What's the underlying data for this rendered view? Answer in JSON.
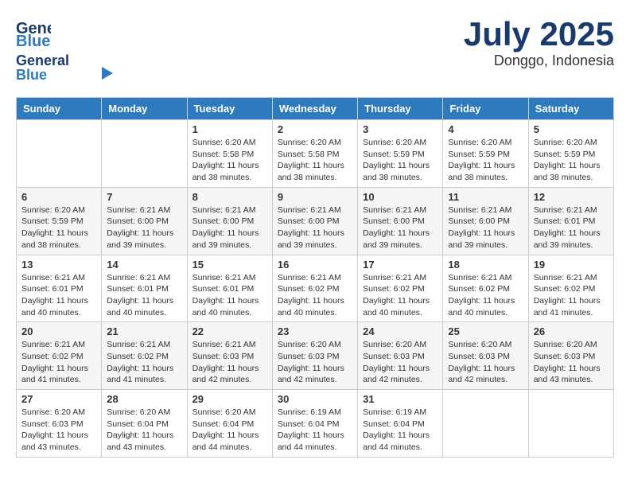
{
  "header": {
    "logo_line1": "General",
    "logo_line2": "Blue",
    "month": "July 2025",
    "location": "Donggo, Indonesia"
  },
  "weekdays": [
    "Sunday",
    "Monday",
    "Tuesday",
    "Wednesday",
    "Thursday",
    "Friday",
    "Saturday"
  ],
  "weeks": [
    [
      {
        "day": "",
        "content": ""
      },
      {
        "day": "",
        "content": ""
      },
      {
        "day": "1",
        "content": "Sunrise: 6:20 AM\nSunset: 5:58 PM\nDaylight: 11 hours and 38 minutes."
      },
      {
        "day": "2",
        "content": "Sunrise: 6:20 AM\nSunset: 5:58 PM\nDaylight: 11 hours and 38 minutes."
      },
      {
        "day": "3",
        "content": "Sunrise: 6:20 AM\nSunset: 5:59 PM\nDaylight: 11 hours and 38 minutes."
      },
      {
        "day": "4",
        "content": "Sunrise: 6:20 AM\nSunset: 5:59 PM\nDaylight: 11 hours and 38 minutes."
      },
      {
        "day": "5",
        "content": "Sunrise: 6:20 AM\nSunset: 5:59 PM\nDaylight: 11 hours and 38 minutes."
      }
    ],
    [
      {
        "day": "6",
        "content": "Sunrise: 6:20 AM\nSunset: 5:59 PM\nDaylight: 11 hours and 38 minutes."
      },
      {
        "day": "7",
        "content": "Sunrise: 6:21 AM\nSunset: 6:00 PM\nDaylight: 11 hours and 39 minutes."
      },
      {
        "day": "8",
        "content": "Sunrise: 6:21 AM\nSunset: 6:00 PM\nDaylight: 11 hours and 39 minutes."
      },
      {
        "day": "9",
        "content": "Sunrise: 6:21 AM\nSunset: 6:00 PM\nDaylight: 11 hours and 39 minutes."
      },
      {
        "day": "10",
        "content": "Sunrise: 6:21 AM\nSunset: 6:00 PM\nDaylight: 11 hours and 39 minutes."
      },
      {
        "day": "11",
        "content": "Sunrise: 6:21 AM\nSunset: 6:00 PM\nDaylight: 11 hours and 39 minutes."
      },
      {
        "day": "12",
        "content": "Sunrise: 6:21 AM\nSunset: 6:01 PM\nDaylight: 11 hours and 39 minutes."
      }
    ],
    [
      {
        "day": "13",
        "content": "Sunrise: 6:21 AM\nSunset: 6:01 PM\nDaylight: 11 hours and 40 minutes."
      },
      {
        "day": "14",
        "content": "Sunrise: 6:21 AM\nSunset: 6:01 PM\nDaylight: 11 hours and 40 minutes."
      },
      {
        "day": "15",
        "content": "Sunrise: 6:21 AM\nSunset: 6:01 PM\nDaylight: 11 hours and 40 minutes."
      },
      {
        "day": "16",
        "content": "Sunrise: 6:21 AM\nSunset: 6:02 PM\nDaylight: 11 hours and 40 minutes."
      },
      {
        "day": "17",
        "content": "Sunrise: 6:21 AM\nSunset: 6:02 PM\nDaylight: 11 hours and 40 minutes."
      },
      {
        "day": "18",
        "content": "Sunrise: 6:21 AM\nSunset: 6:02 PM\nDaylight: 11 hours and 40 minutes."
      },
      {
        "day": "19",
        "content": "Sunrise: 6:21 AM\nSunset: 6:02 PM\nDaylight: 11 hours and 41 minutes."
      }
    ],
    [
      {
        "day": "20",
        "content": "Sunrise: 6:21 AM\nSunset: 6:02 PM\nDaylight: 11 hours and 41 minutes."
      },
      {
        "day": "21",
        "content": "Sunrise: 6:21 AM\nSunset: 6:02 PM\nDaylight: 11 hours and 41 minutes."
      },
      {
        "day": "22",
        "content": "Sunrise: 6:21 AM\nSunset: 6:03 PM\nDaylight: 11 hours and 42 minutes."
      },
      {
        "day": "23",
        "content": "Sunrise: 6:20 AM\nSunset: 6:03 PM\nDaylight: 11 hours and 42 minutes."
      },
      {
        "day": "24",
        "content": "Sunrise: 6:20 AM\nSunset: 6:03 PM\nDaylight: 11 hours and 42 minutes."
      },
      {
        "day": "25",
        "content": "Sunrise: 6:20 AM\nSunset: 6:03 PM\nDaylight: 11 hours and 42 minutes."
      },
      {
        "day": "26",
        "content": "Sunrise: 6:20 AM\nSunset: 6:03 PM\nDaylight: 11 hours and 43 minutes."
      }
    ],
    [
      {
        "day": "27",
        "content": "Sunrise: 6:20 AM\nSunset: 6:03 PM\nDaylight: 11 hours and 43 minutes."
      },
      {
        "day": "28",
        "content": "Sunrise: 6:20 AM\nSunset: 6:04 PM\nDaylight: 11 hours and 43 minutes."
      },
      {
        "day": "29",
        "content": "Sunrise: 6:20 AM\nSunset: 6:04 PM\nDaylight: 11 hours and 44 minutes."
      },
      {
        "day": "30",
        "content": "Sunrise: 6:19 AM\nSunset: 6:04 PM\nDaylight: 11 hours and 44 minutes."
      },
      {
        "day": "31",
        "content": "Sunrise: 6:19 AM\nSunset: 6:04 PM\nDaylight: 11 hours and 44 minutes."
      },
      {
        "day": "",
        "content": ""
      },
      {
        "day": "",
        "content": ""
      }
    ]
  ]
}
